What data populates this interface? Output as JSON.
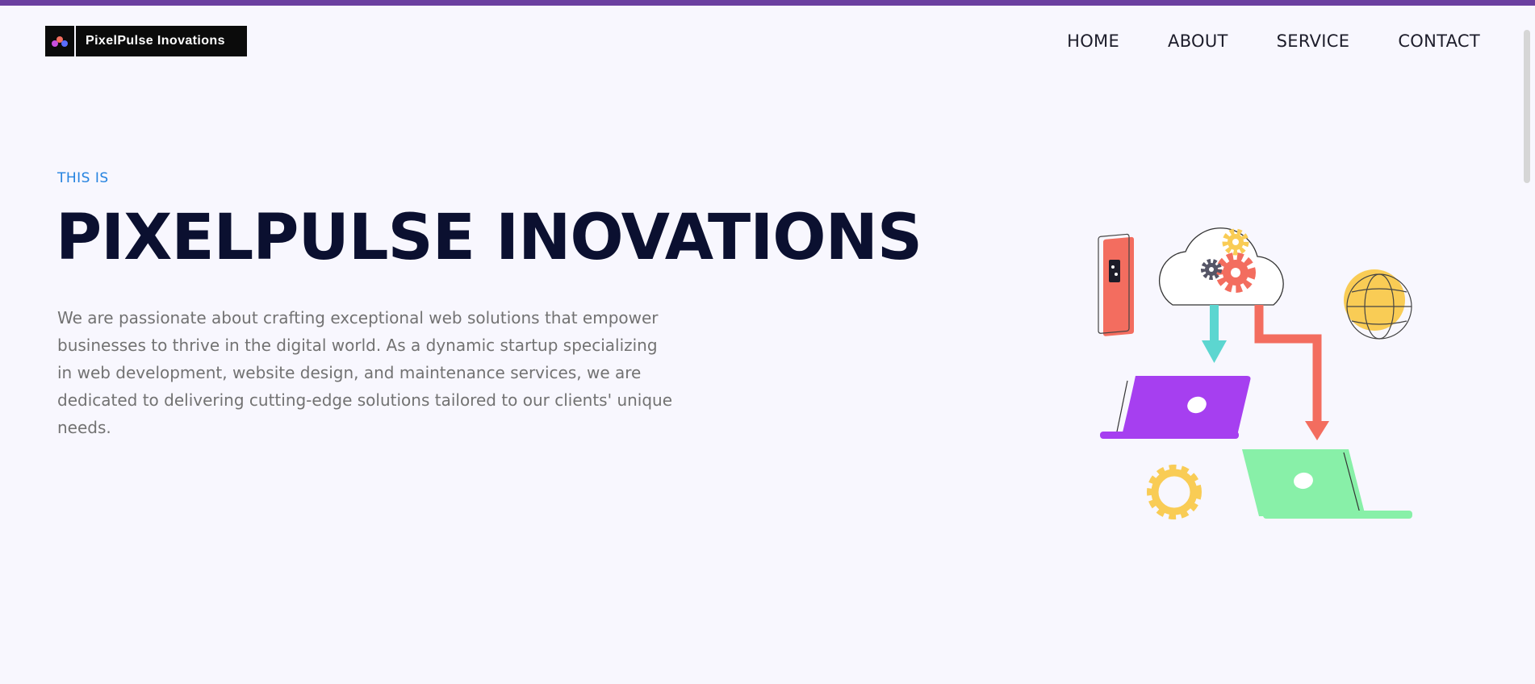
{
  "brand": {
    "name": "PixelPulse Inovations"
  },
  "nav": {
    "home": "HOME",
    "about": "ABOUT",
    "service": "SERVICE",
    "contact": "CONTACT"
  },
  "hero": {
    "eyebrow": "THIS IS",
    "title": "PIXELPULSE INOVATIONS",
    "description": "We are passionate about crafting exceptional web solutions that empower businesses to thrive in the digital world. As a dynamic startup specializing in web development, website design, and maintenance services, we are dedicated to delivering cutting-edge solutions tailored to our clients' unique needs."
  },
  "colors": {
    "accent_bar": "#6b3fa0",
    "eyebrow": "#2583e0",
    "title": "#0b1030",
    "laptop_purple": "#a63ff0",
    "laptop_green": "#88f0a8",
    "arrow_teal": "#5cd6d0",
    "arrow_red": "#f36d5f",
    "gear_yellow": "#f9cc55"
  }
}
